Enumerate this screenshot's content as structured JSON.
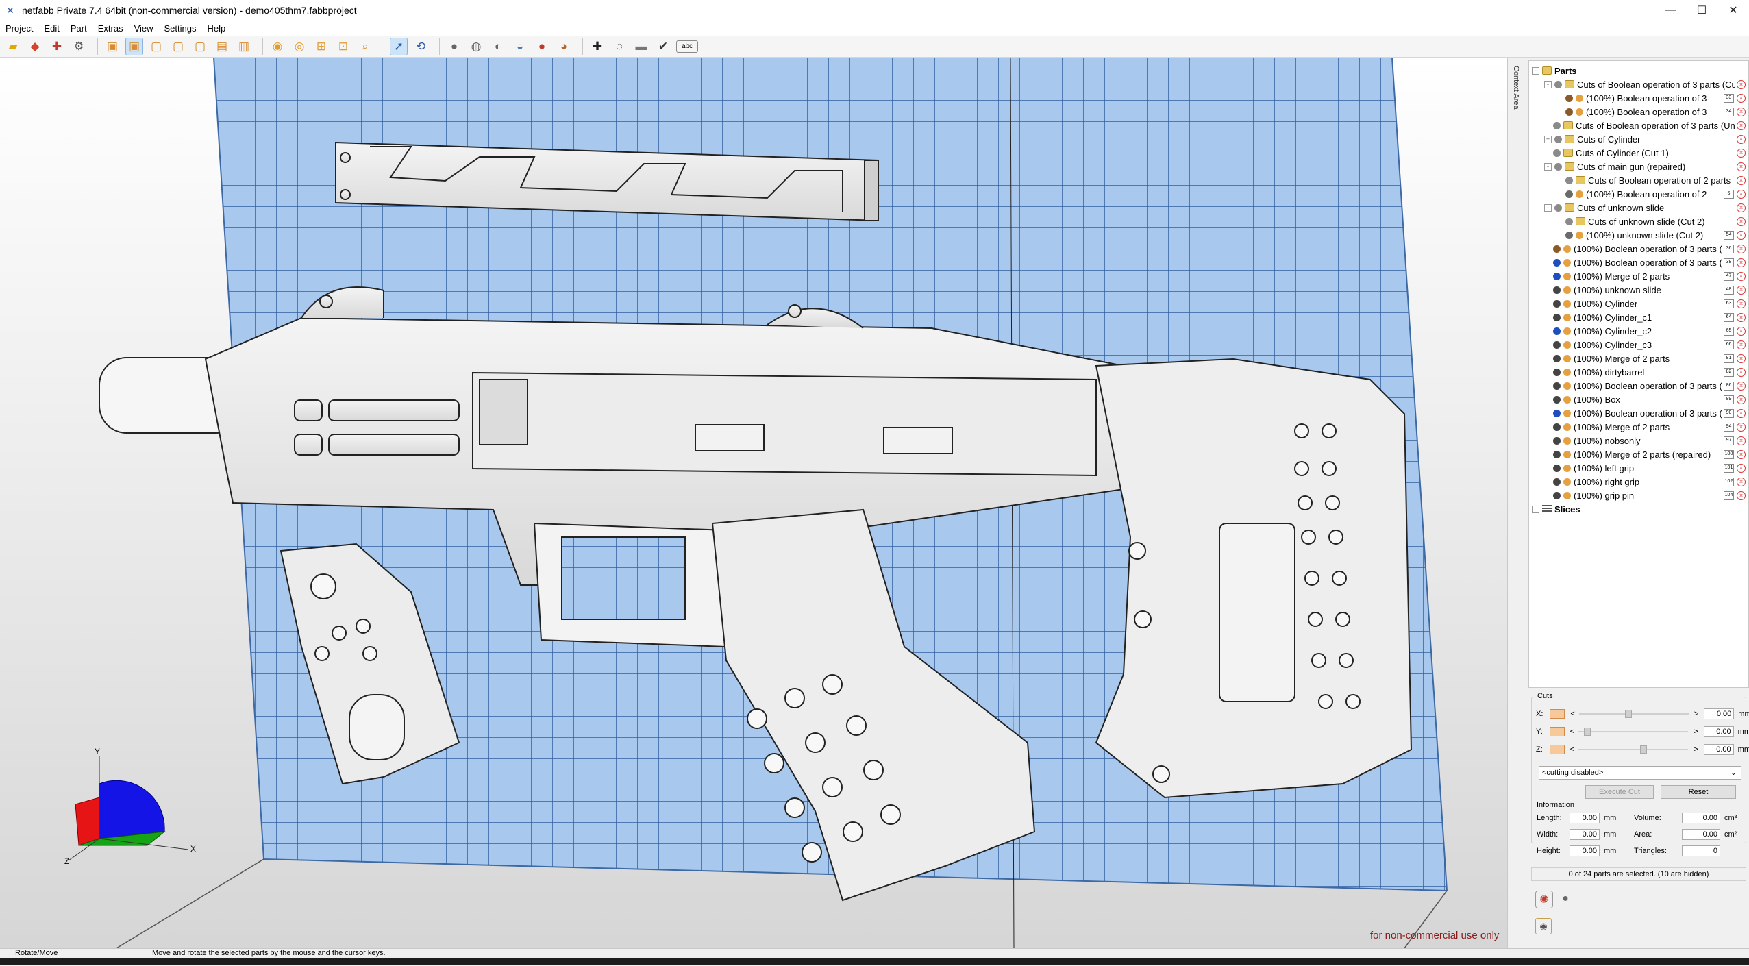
{
  "window": {
    "title": "netfabb Private 7.4 64bit (non-commercial version) - demo405thm7.fabbproject"
  },
  "menu": [
    "Project",
    "Edit",
    "Part",
    "Extras",
    "View",
    "Settings",
    "Help"
  ],
  "context_tab": "Context Area",
  "watermark": "for non-commercial use only",
  "axes": {
    "x": "X",
    "y": "Y",
    "z": "Z"
  },
  "tree": {
    "parts_label": "Parts",
    "slices_label": "Slices",
    "items": [
      {
        "level": 1,
        "type": "folder",
        "exp": "-",
        "label": "Cuts of Boolean operation of 3 parts (Cut"
      },
      {
        "level": 2,
        "type": "part",
        "color": "#8a5a2b",
        "label": "(100%) Boolean operation of 3",
        "num": "33"
      },
      {
        "level": 2,
        "type": "part",
        "color": "#8a5a2b",
        "label": "(100%) Boolean operation of 3",
        "num": "34"
      },
      {
        "level": 1,
        "type": "folder",
        "exp": "",
        "label": "Cuts of Boolean operation of 3 parts (Un"
      },
      {
        "level": 1,
        "type": "folder",
        "exp": "+",
        "label": "Cuts of Cylinder"
      },
      {
        "level": 1,
        "type": "folder",
        "exp": "",
        "label": "Cuts of Cylinder (Cut 1)"
      },
      {
        "level": 1,
        "type": "folder",
        "exp": "-",
        "label": "Cuts of main gun (repaired)"
      },
      {
        "level": 2,
        "type": "folder",
        "exp": "",
        "label": "Cuts of Boolean operation of 2 parts"
      },
      {
        "level": 2,
        "type": "part",
        "color": "#6a6a6a",
        "label": "(100%) Boolean operation of 2",
        "num": "6"
      },
      {
        "level": 1,
        "type": "folder",
        "exp": "-",
        "label": "Cuts of unknown slide"
      },
      {
        "level": 2,
        "type": "folder",
        "exp": "",
        "label": "Cuts of unknown slide (Cut 2)"
      },
      {
        "level": 2,
        "type": "part",
        "color": "#6a6a6a",
        "label": "(100%) unknown slide (Cut 2)",
        "num": "54"
      },
      {
        "level": 1,
        "type": "part",
        "color": "#8a5a2b",
        "label": "(100%) Boolean operation of 3 parts (Un",
        "num": "36"
      },
      {
        "level": 1,
        "type": "part",
        "color": "#1f4fbf",
        "label": "(100%) Boolean operation of 3 parts (Un",
        "num": "38"
      },
      {
        "level": 1,
        "type": "part",
        "color": "#1f4fbf",
        "label": "(100%) Merge of 2 parts",
        "num": "47"
      },
      {
        "level": 1,
        "type": "part",
        "color": "#444444",
        "label": "(100%) unknown slide",
        "num": "48"
      },
      {
        "level": 1,
        "type": "part",
        "color": "#444444",
        "label": "(100%) Cylinder",
        "num": "63"
      },
      {
        "level": 1,
        "type": "part",
        "color": "#444444",
        "label": "(100%) Cylinder_c1",
        "num": "64"
      },
      {
        "level": 1,
        "type": "part",
        "color": "#1f4fbf",
        "label": "(100%) Cylinder_c2",
        "num": "65"
      },
      {
        "level": 1,
        "type": "part",
        "color": "#444444",
        "label": "(100%) Cylinder_c3",
        "num": "66"
      },
      {
        "level": 1,
        "type": "part",
        "color": "#444444",
        "label": "(100%) Merge of 2 parts",
        "num": "81"
      },
      {
        "level": 1,
        "type": "part",
        "color": "#444444",
        "label": "(100%) dirtybarrel",
        "num": "82"
      },
      {
        "level": 1,
        "type": "part",
        "color": "#444444",
        "label": "(100%) Boolean operation of 3 parts (Un",
        "num": "86"
      },
      {
        "level": 1,
        "type": "part",
        "color": "#444444",
        "label": "(100%) Box",
        "num": "89"
      },
      {
        "level": 1,
        "type": "part",
        "color": "#1f4fbf",
        "label": "(100%) Boolean operation of 3 parts (Un",
        "num": "90"
      },
      {
        "level": 1,
        "type": "part",
        "color": "#444444",
        "label": "(100%) Merge of 2 parts",
        "num": "94"
      },
      {
        "level": 1,
        "type": "part",
        "color": "#444444",
        "label": "(100%) nobsonly",
        "num": "97"
      },
      {
        "level": 1,
        "type": "part",
        "color": "#444444",
        "label": "(100%) Merge of 2 parts (repaired)",
        "num": "100"
      },
      {
        "level": 1,
        "type": "part",
        "color": "#444444",
        "label": "(100%) left grip",
        "num": "101"
      },
      {
        "level": 1,
        "type": "part",
        "color": "#444444",
        "label": "(100%) right grip",
        "num": "102"
      },
      {
        "level": 1,
        "type": "part",
        "color": "#444444",
        "label": "(100%) grip pin",
        "num": "104"
      }
    ]
  },
  "cuts": {
    "title": "Cuts",
    "rows": [
      {
        "axis": "X:",
        "value": "0.00",
        "unit": "mm",
        "knob": 0.45
      },
      {
        "axis": "Y:",
        "value": "0.00",
        "unit": "mm",
        "knob": 0.05
      },
      {
        "axis": "Z:",
        "value": "0.00",
        "unit": "mm",
        "knob": 0.6
      }
    ],
    "dropdown": "<cutting disabled>",
    "execute_label": "Execute Cut",
    "reset_label": "Reset"
  },
  "information": {
    "title": "Information",
    "left": [
      {
        "label": "Length:",
        "value": "0.00",
        "unit": "mm"
      },
      {
        "label": "Width:",
        "value": "0.00",
        "unit": "mm"
      },
      {
        "label": "Height:",
        "value": "0.00",
        "unit": "mm"
      }
    ],
    "right": [
      {
        "label": "Volume:",
        "value": "0.00",
        "unit": "cm³"
      },
      {
        "label": "Area:",
        "value": "0.00",
        "unit": "cm²"
      },
      {
        "label": "Triangles:",
        "value": "0",
        "unit": ""
      }
    ],
    "selection": "0 of 24 parts are selected. (10 are hidden)"
  },
  "status": {
    "mode": "Rotate/Move",
    "hint": "Move and rotate the selected parts by the mouse and the cursor keys."
  }
}
